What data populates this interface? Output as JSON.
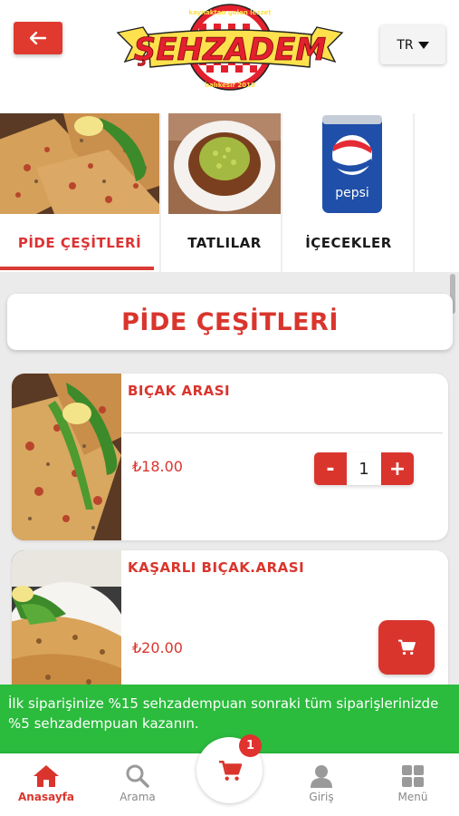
{
  "header": {
    "logo": {
      "top_text": "kaynaktan gelen lezzet",
      "name": "ŞEHZADEM",
      "bottom_text": "balıkesir 2010"
    },
    "language": "TR"
  },
  "categories": [
    {
      "label": "PİDE ÇEŞİTLERİ",
      "active": true
    },
    {
      "label": "TATLILAR",
      "active": false
    },
    {
      "label": "İÇECEKLER",
      "active": false
    }
  ],
  "section": {
    "title": "PİDE ÇEŞİTLERİ"
  },
  "products": [
    {
      "name": "BIÇAK ARASI",
      "price": "₺18.00",
      "quantity": "1",
      "minus": "-",
      "plus": "+"
    },
    {
      "name": "KAŞARLI BIÇAK.ARASI",
      "price": "₺20.00"
    }
  ],
  "promo": {
    "text": "İlk siparişinize %15 sehzadempuan sonraki tüm siparişlerinizde %5 sehzadempuan kazanın."
  },
  "bottom_nav": {
    "items": [
      {
        "label": "Anasayfa",
        "icon": "home-icon",
        "active": true
      },
      {
        "label": "Arama",
        "icon": "search-icon",
        "active": false
      },
      {
        "label": "Giriş",
        "icon": "user-icon",
        "active": false
      },
      {
        "label": "Menü",
        "icon": "grid-icon",
        "active": false
      }
    ],
    "cart_count": "1"
  },
  "colors": {
    "brand_red": "#d9352d",
    "promo_green": "#2bbb3d",
    "logo_yellow": "#ffe14d"
  }
}
